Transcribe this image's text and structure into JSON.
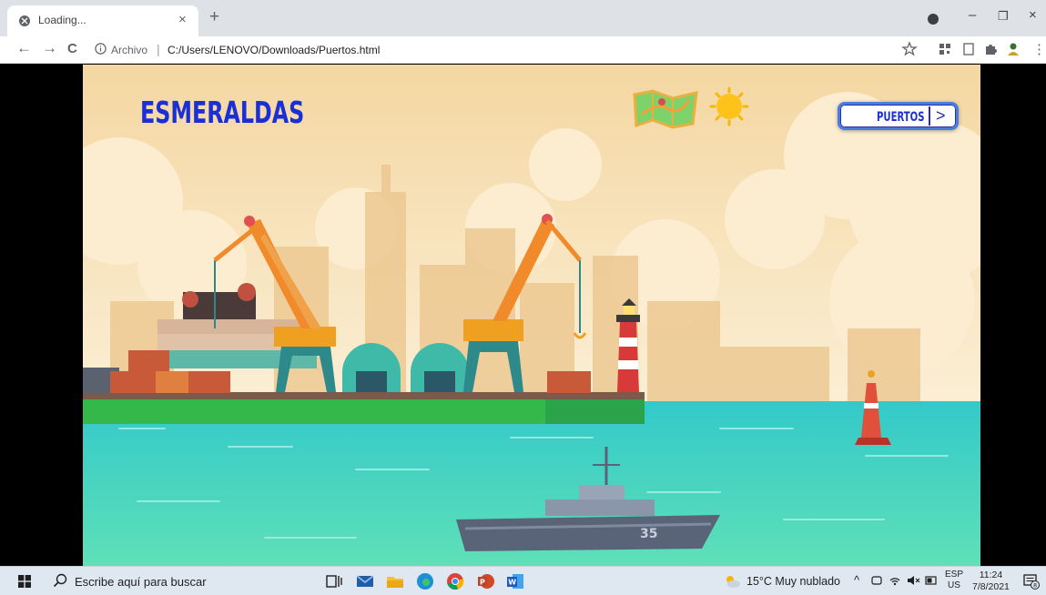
{
  "browser": {
    "tab_title": "Loading...",
    "tab_close": "×",
    "new_tab": "+",
    "window_minimize": "–",
    "window_restore": "❐",
    "window_close": "×",
    "nav_back": "←",
    "nav_forward": "→",
    "nav_reload": "C",
    "url_scheme_label": "Archivo",
    "url_separator": "|",
    "url": "C:/Users/LENOVO/Downloads/Puertos.html",
    "overflow_menu": "⋮"
  },
  "page": {
    "title": "ESMERALDAS",
    "puertos_button": "PUERTOS",
    "puertos_arrow": ">",
    "ship_number": "35",
    "icons": [
      "map-icon",
      "sun-icon"
    ]
  },
  "taskbar": {
    "search_placeholder": "Escribe aquí para buscar",
    "apps": [
      "task-view-icon",
      "mail-icon",
      "file-explorer-icon",
      "edge-icon",
      "chrome-icon",
      "powerpoint-icon",
      "word-icon"
    ],
    "weather": "15°C  Muy nublado",
    "tray_chevron": "^",
    "lang_top": "ESP",
    "lang_bottom": "US",
    "time": "11:24",
    "date": "7/8/2021",
    "notification_count": "8"
  },
  "colors": {
    "title_blue": "#1a2fd6",
    "sea": "#3fd2c9",
    "sky": "#f7e3b8",
    "crane_orange": "#f08a2a",
    "dock_green": "#34b84a"
  }
}
